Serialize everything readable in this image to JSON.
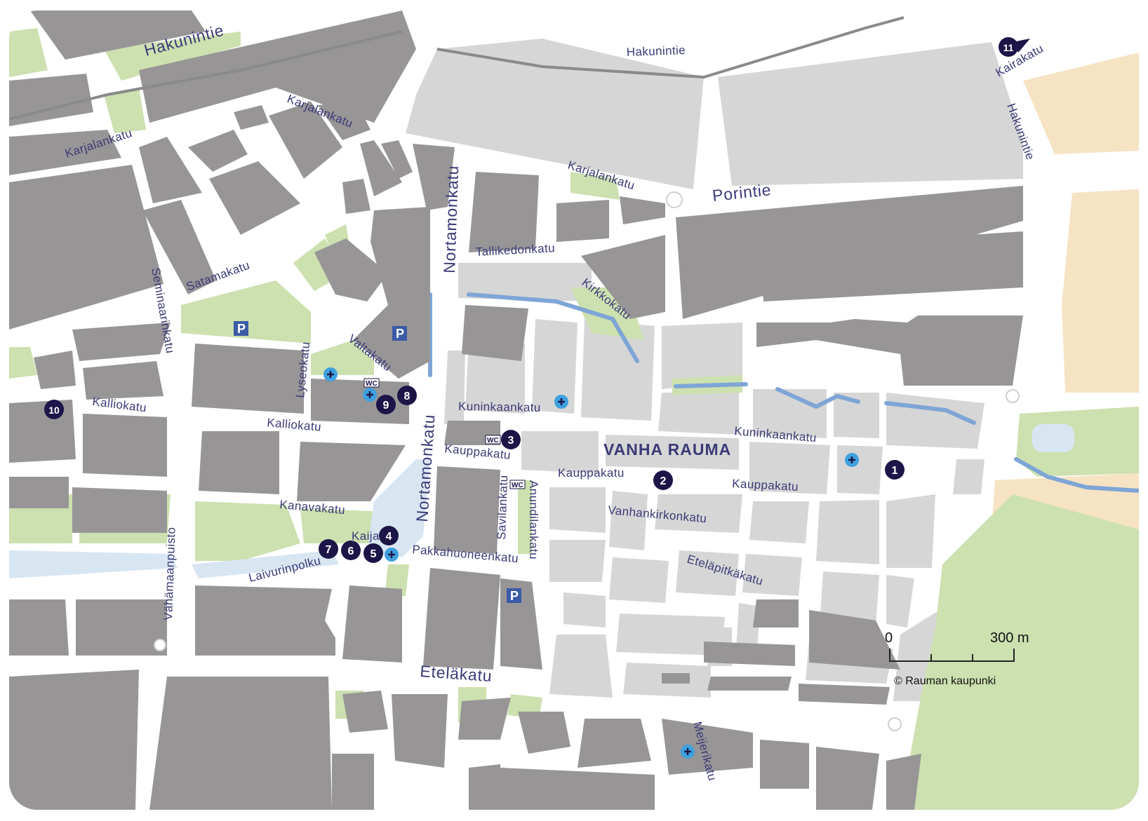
{
  "colors": {
    "background": "#f2f2f2",
    "road": "#ffffff",
    "block_dark": "#989597",
    "block_light": "#d6d6d6",
    "park": "#cde0b0",
    "sand": "#f6e3c3",
    "water": "#d8e6f2",
    "canal": "#7ea5d6",
    "marker": "#1c1548",
    "cross": "#3fa1df",
    "parking": "#3a5aa6",
    "label": "#3a3a78"
  },
  "streets": {
    "hakunintie_1": "Hakunintie",
    "hakunintie_2": "Hakunintie",
    "hakunintie_3": "Hakunintie",
    "karjalankatu_1": "Karjalankatu",
    "karjalankatu_2": "Karjalankatu",
    "karjalankatu_3": "Karjalankatu",
    "kairakatu": "Kairakatu",
    "porintie": "Porintie",
    "nortamonkatu_1": "Nortamonkatu",
    "nortamonkatu_2": "Nortamonkatu",
    "tallikedonkatu": "Tallikedonkatu",
    "kirkkokatu": "Kirkkokatu",
    "satamakatu": "Satamakatu",
    "seminaarinkatu": "Seminaarinkatu",
    "valtakatu": "Valtakatu",
    "lyseokatu": "Lyseokatu",
    "kalliokatu_1": "Kalliokatu",
    "kalliokatu_2": "Kalliokatu",
    "kuninkaankatu_1": "Kuninkaankatu",
    "kuninkaankatu_2": "Kuninkaankatu",
    "kauppakatu_1": "Kauppakatu",
    "kauppakatu_2": "Kauppakatu",
    "kauppakatu_3": "Kauppakatu",
    "kanavakatu": "Kanavakatu",
    "savilankatu": "Savilankatu",
    "anundilankatu": "Anundilankatu",
    "vanhankirkonkatu": "Vanhankirkonkatu",
    "kaija": "Kaija",
    "pakkahuoneenkatu": "Pakkahuoneenkatu",
    "laivurinpolku": "Laivurinpolku",
    "vahamaanpuisto": "Vähämaanpuisto",
    "etelapitkakatu": "Eteläpitkäkatu",
    "etelakatu": "Eteläkatu",
    "meijerikatu": "Meijerikatu"
  },
  "district": "VANHA RAUMA",
  "markers": [
    "1",
    "2",
    "3",
    "4",
    "5",
    "6",
    "7",
    "8",
    "9",
    "10",
    "11"
  ],
  "parking_label": "P",
  "wc_label": "WC",
  "scale": {
    "start": "0",
    "end": "300 m"
  },
  "copyright": "© Rauman kaupunki"
}
